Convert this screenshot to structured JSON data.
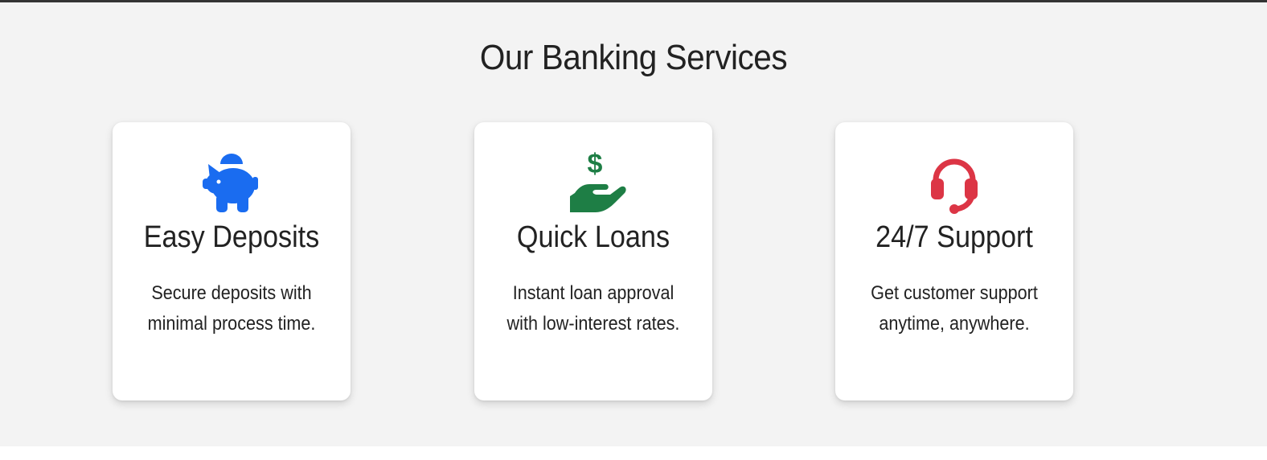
{
  "section": {
    "title": "Our Banking Services"
  },
  "cards": [
    {
      "icon": "piggy-bank-icon",
      "icon_color": "#1a6cf0",
      "title": "Easy Deposits",
      "desc_line1": "Secure deposits with",
      "desc_line2": "minimal process time."
    },
    {
      "icon": "hand-holding-dollar-icon",
      "icon_color": "#1e7e45",
      "title": "Quick Loans",
      "desc_line1": "Instant loan approval",
      "desc_line2": "with low-interest rates."
    },
    {
      "icon": "headset-icon",
      "icon_color": "#dc3545",
      "title": "24/7 Support",
      "desc_line1": "Get customer support",
      "desc_line2": "anytime, anywhere."
    }
  ]
}
